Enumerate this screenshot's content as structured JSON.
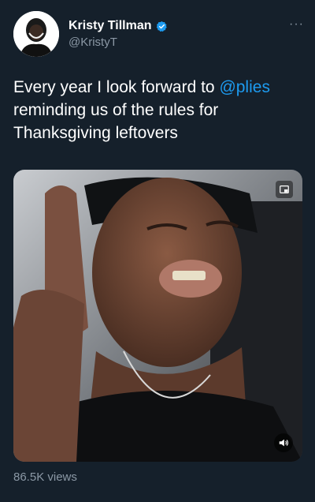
{
  "author": {
    "display_name": "Kristy Tillman",
    "handle": "@KristyT",
    "verified": true,
    "avatar_icon": "profile-avatar"
  },
  "tweet": {
    "text_before": "Every year I look forward to ",
    "mention": "@plies",
    "text_after": " reminding us of the rules for Thanksgiving leftovers"
  },
  "media": {
    "type": "video",
    "controls": [
      "picture-in-picture-icon",
      "volume-icon"
    ]
  },
  "stats": {
    "views": "86.5K views"
  },
  "colors": {
    "background": "#15202b",
    "accent": "#1d9bf0",
    "secondary_text": "#8b98a5"
  }
}
